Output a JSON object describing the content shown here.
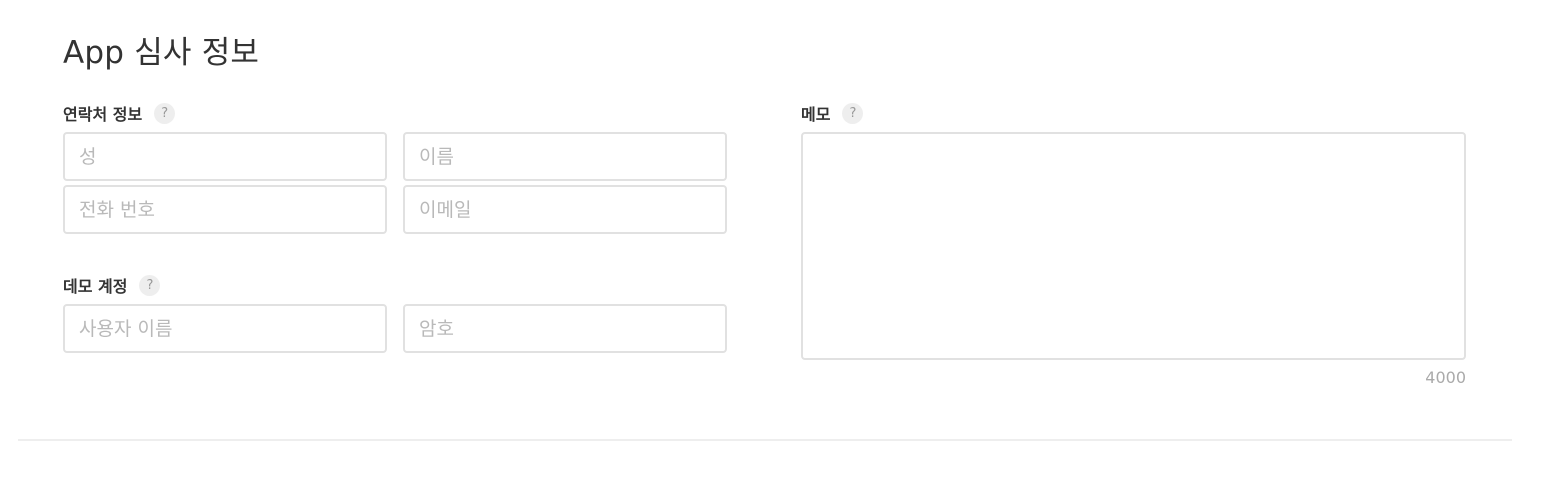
{
  "section": {
    "title": "App 심사 정보"
  },
  "contact": {
    "label": "연락처 정보",
    "help": "?",
    "last_name": {
      "placeholder": "성",
      "value": ""
    },
    "first_name": {
      "placeholder": "이름",
      "value": ""
    },
    "phone": {
      "placeholder": "전화 번호",
      "value": ""
    },
    "email": {
      "placeholder": "이메일",
      "value": ""
    }
  },
  "demo_account": {
    "label": "데모 계정",
    "help": "?",
    "username": {
      "placeholder": "사용자 이름",
      "value": ""
    },
    "password": {
      "placeholder": "암호",
      "value": ""
    }
  },
  "notes": {
    "label": "메모",
    "help": "?",
    "value": "",
    "remaining_chars": "4000"
  }
}
